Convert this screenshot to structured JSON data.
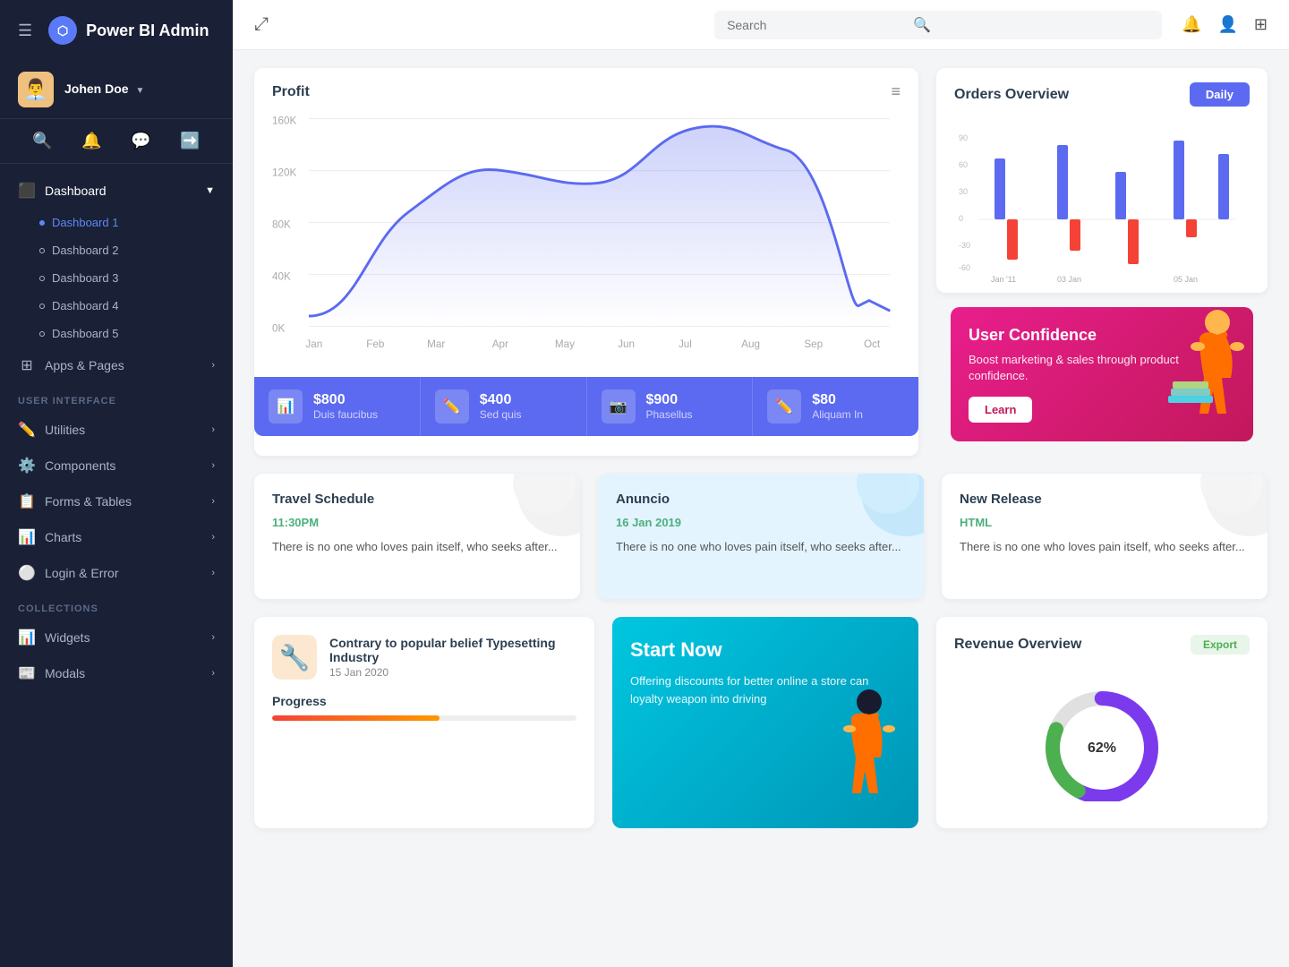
{
  "brand": {
    "name": "Power BI Admin",
    "logo_symbol": "⬡"
  },
  "user": {
    "name": "Johen Doe",
    "avatar_emoji": "👨‍💼"
  },
  "sidebar": {
    "nav_items": [
      {
        "label": "Dashboard",
        "icon": "⬛",
        "has_arrow": true,
        "expanded": true
      },
      {
        "label": "Apps & Pages",
        "icon": "⊞",
        "has_arrow": true
      }
    ],
    "dashboard_subs": [
      {
        "label": "Dashboard 1",
        "active": true
      },
      {
        "label": "Dashboard 2"
      },
      {
        "label": "Dashboard 3"
      },
      {
        "label": "Dashboard 4"
      },
      {
        "label": "Dashboard 5"
      }
    ],
    "sections": [
      {
        "label": "USER INTERFACE",
        "items": [
          {
            "label": "Utilities",
            "icon": "✏️",
            "has_arrow": true
          },
          {
            "label": "Components",
            "icon": "⚙️",
            "has_arrow": true
          },
          {
            "label": "Forms & Tables",
            "icon": "📋",
            "has_arrow": true
          },
          {
            "label": "Charts",
            "icon": "📊",
            "has_arrow": true
          },
          {
            "label": "Login & Error",
            "icon": "⚪",
            "has_arrow": true
          }
        ]
      },
      {
        "label": "COLLECTIONS",
        "items": [
          {
            "label": "Widgets",
            "icon": "📊",
            "has_arrow": true
          },
          {
            "label": "Modals",
            "icon": "📰",
            "has_arrow": true
          }
        ]
      }
    ]
  },
  "topbar": {
    "search_placeholder": "Search",
    "expand_icon": "⤢"
  },
  "profit_chart": {
    "title": "Profit",
    "y_labels": [
      "160K",
      "120K",
      "80K",
      "40K",
      "0K"
    ],
    "x_labels": [
      "Jan",
      "Feb",
      "Mar",
      "Apr",
      "May",
      "Jun",
      "Jul",
      "Aug",
      "Sep",
      "Oct"
    ]
  },
  "stats": [
    {
      "value": "$800",
      "label": "Duis faucibus",
      "icon": "📊",
      "color": "#4CAF50"
    },
    {
      "value": "$400",
      "label": "Sed quis",
      "icon": "✏️",
      "color": "#FF9800"
    },
    {
      "value": "$900",
      "label": "Phasellus",
      "icon": "📷",
      "color": "#2196F3"
    },
    {
      "value": "$80",
      "label": "Aliquam In",
      "icon": "✏️",
      "color": "#9C27B0"
    }
  ],
  "orders_overview": {
    "title": "Orders Overview",
    "button_label": "Daily",
    "x_labels": [
      "Jan '11",
      "03 Jan",
      "05 Jan"
    ]
  },
  "user_confidence": {
    "title": "User Confidence",
    "text": "Boost marketing & sales through product confidence.",
    "button_label": "Learn"
  },
  "info_cards": [
    {
      "time": "11:30PM",
      "title": "Travel Schedule",
      "body": "There is no one who loves pain itself, who seeks after...",
      "bg": "#fff"
    },
    {
      "time": "16 Jan 2019",
      "title": "Anuncio",
      "body": "There is no one who loves pain itself, who seeks after...",
      "bg": "#e3f4ff"
    },
    {
      "time": "HTML",
      "title": "New Release",
      "body": "There is no one who loves pain itself, who seeks after...",
      "bg": "#fff"
    }
  ],
  "news_card": {
    "title": "Contrary to popular belief Typesetting Industry",
    "date": "15 Jan 2020",
    "progress_label": "Progress"
  },
  "start_now": {
    "title": "Start Now",
    "text": "Offering discounts for better online a store can loyalty weapon into driving"
  },
  "revenue_overview": {
    "title": "Revenue Overview",
    "button_label": "Export"
  }
}
